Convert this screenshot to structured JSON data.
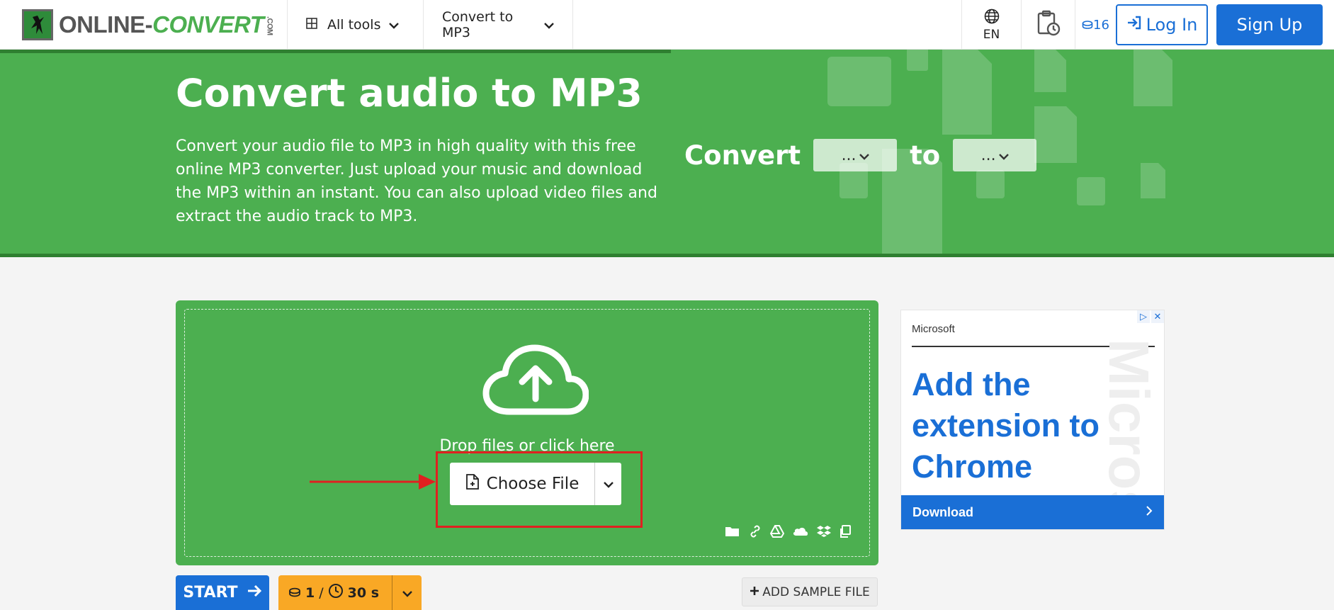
{
  "header": {
    "logo": {
      "part1": "ONLINE-",
      "part2": "CONVERT",
      "suffix": ".COM"
    },
    "nav_all_tools": "All tools",
    "nav_convert": "Convert to MP3",
    "language": "EN",
    "credits": "16",
    "login": "Log In",
    "signup": "Sign Up"
  },
  "hero": {
    "title": "Convert audio to MP3",
    "description": "Convert your audio file to MP3 in high quality with this free online MP3 converter. Just upload your music and download the MP3 within an instant. You can also upload video files and extract the audio track to MP3.",
    "convert_label": "Convert",
    "to_label": "to",
    "from_select": "...",
    "to_select": "..."
  },
  "upload": {
    "drop_text": "Drop files or click here",
    "choose_file": "Choose File"
  },
  "actions": {
    "start": "START",
    "cost_credits": "1",
    "cost_separator": "/",
    "cost_time": "30 s",
    "add_sample": "ADD SAMPLE FILE"
  },
  "ad": {
    "brand": "Microsoft",
    "watermark": "Microso",
    "headline": "Add the extension to Chrome",
    "cta": "Download"
  },
  "colors": {
    "green": "#4caf50",
    "dark_green": "#2f7f31",
    "blue": "#1a6fd6",
    "orange": "#f9a825",
    "highlight_red": "#e02020"
  },
  "icons": {
    "nav_all": "grid-icon",
    "nav_chevron": "chevron-down-icon",
    "language": "globe-icon",
    "history": "clipboard-clock-icon",
    "credits": "coin-icon",
    "login": "login-arrow-icon",
    "upload": "cloud-upload-icon",
    "choose_file": "file-plus-icon",
    "sources": [
      "folder-icon",
      "link-icon",
      "google-drive-icon",
      "onedrive-icon",
      "dropbox-icon",
      "clipboard-icon"
    ]
  }
}
